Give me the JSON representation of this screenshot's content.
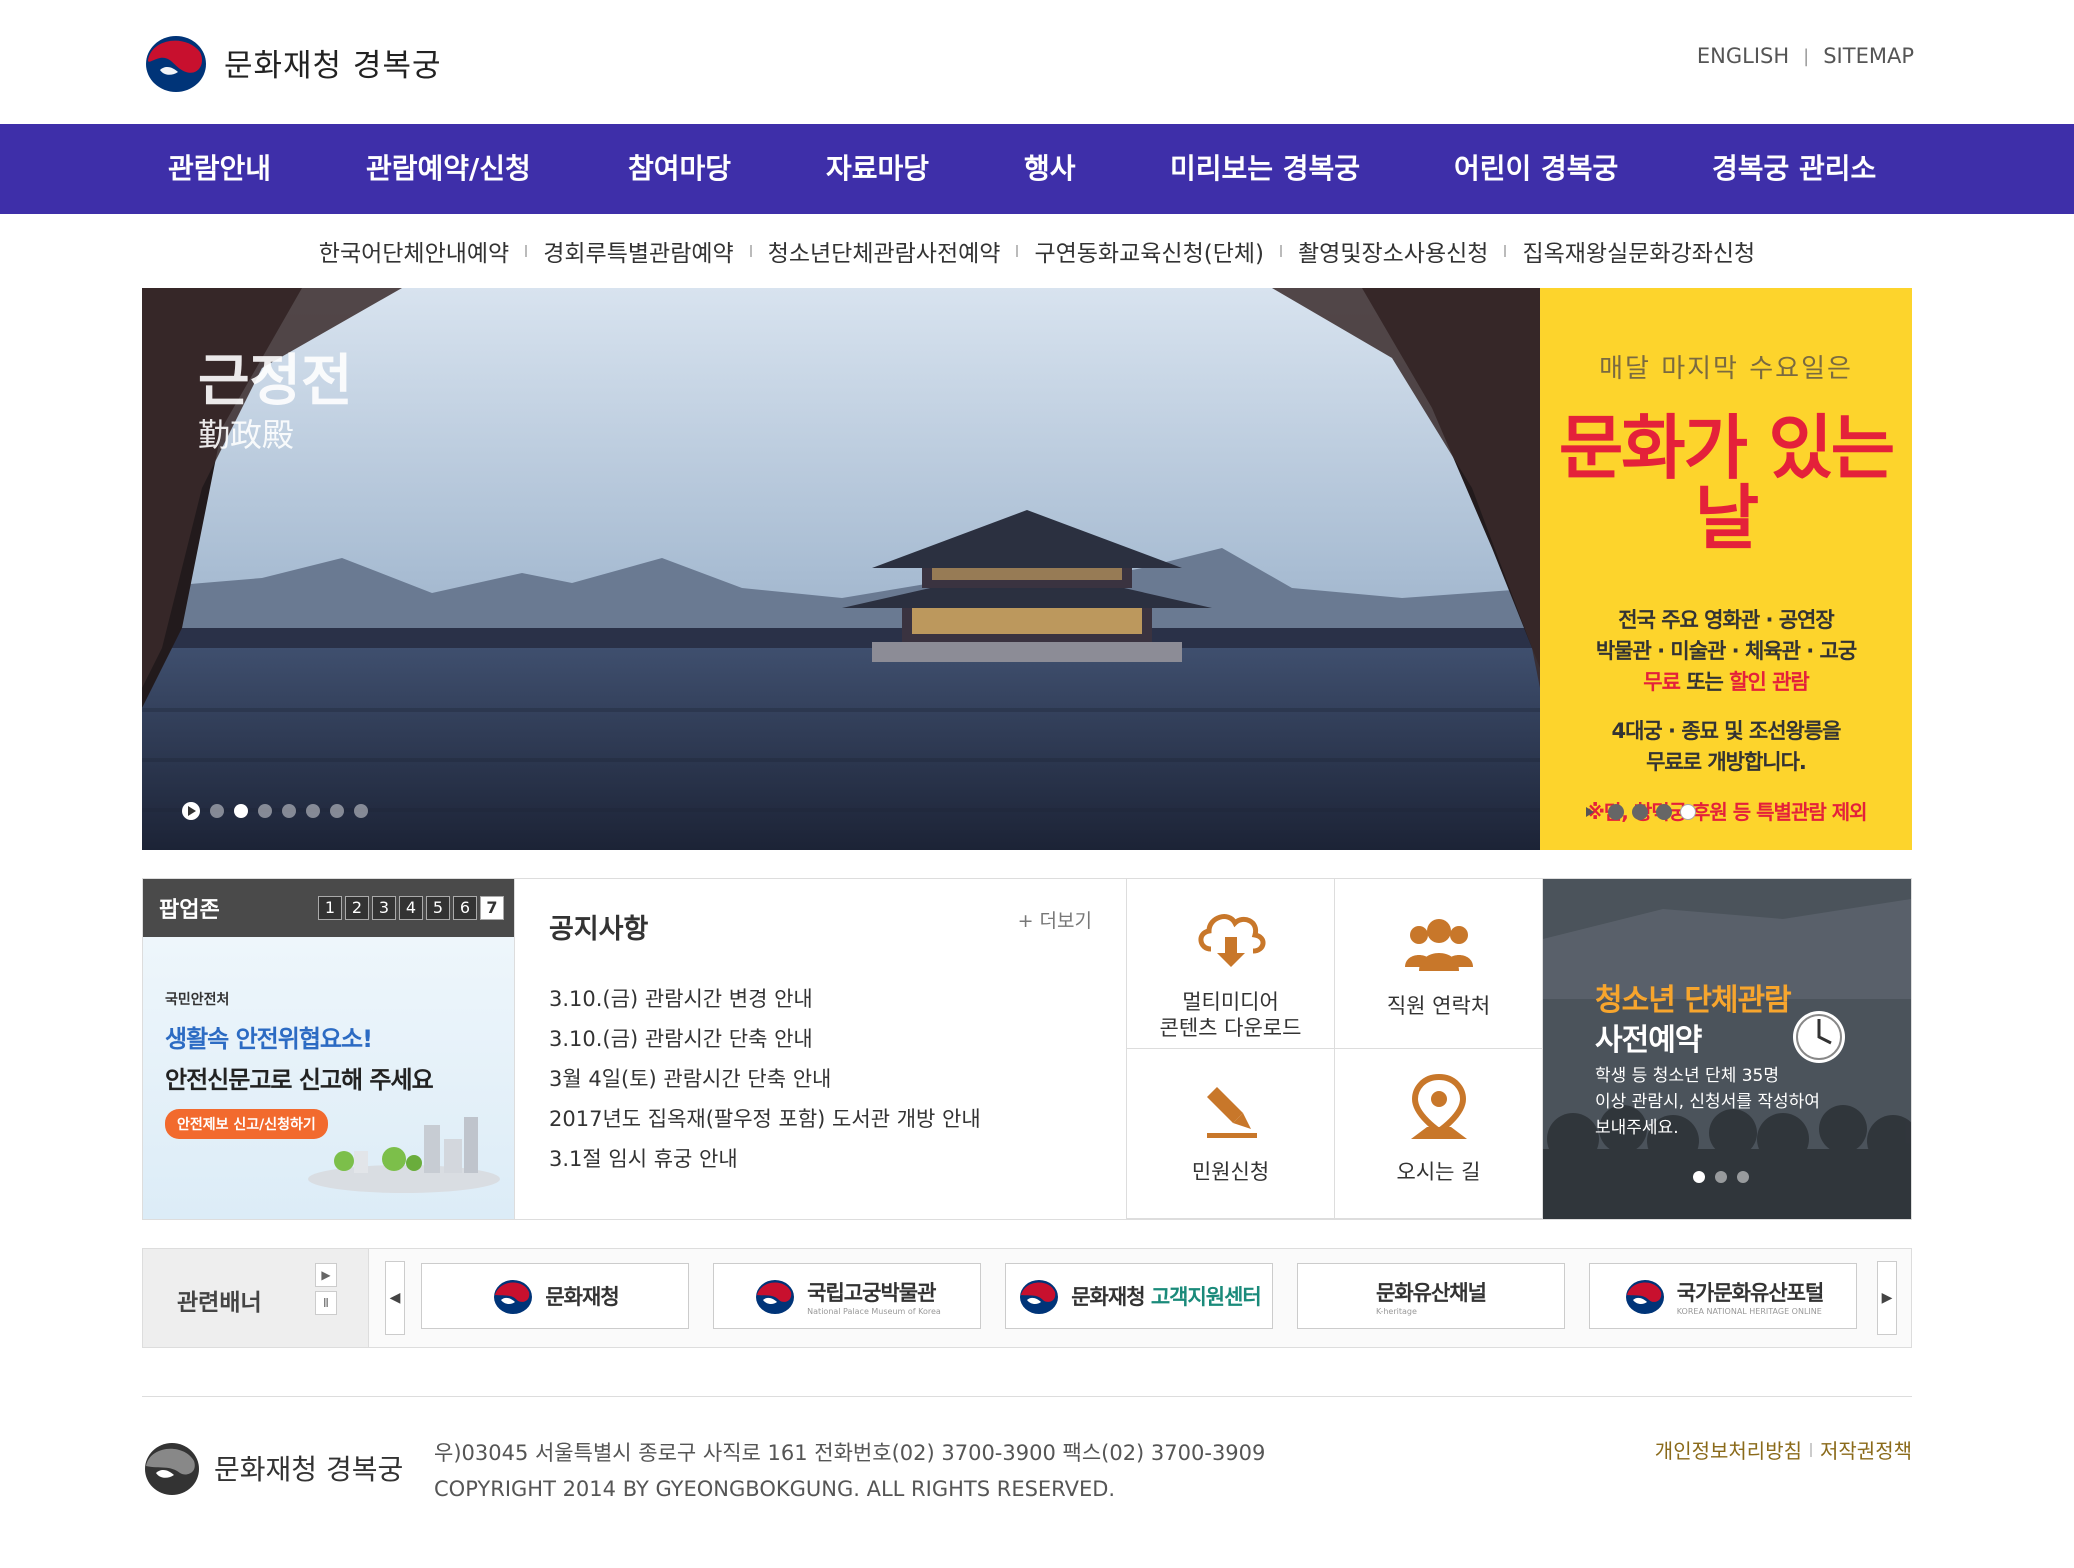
{
  "site": {
    "logo_text": "문화재청 경복궁"
  },
  "util": {
    "english": "ENGLISH",
    "sitemap": "SITEMAP"
  },
  "gnb": {
    "items": [
      "관람안내",
      "관람예약/신청",
      "참여마당",
      "자료마당",
      "행사",
      "미리보는 경복궁",
      "어린이 경복궁",
      "경복궁 관리소"
    ]
  },
  "sub_menu": {
    "items": [
      "한국어단체안내예약",
      "경회루특별관람예약",
      "청소년단체관람사전예약",
      "구연동화교육신청(단체)",
      "촬영및장소사용신청",
      "집옥재왕실문화강좌신청"
    ]
  },
  "visual": {
    "title": "근정전",
    "subtitle": "勤政殿",
    "slide_count": 7,
    "active_slide": 2
  },
  "side_banner": {
    "top": "매달 마지막 수요일은",
    "big": "문화가 있는 날",
    "line1": "전국 주요 영화관 · 공연장",
    "line2": "박물관 · 미술관 · 체육관 · 고궁",
    "free": "무료",
    "or": " 또는 ",
    "discount": "할인 관람",
    "line4": "4대궁 · 종묘 및 조선왕릉을",
    "line5": "무료로 개방합니다.",
    "note": "※단, 창덕궁 후원 등 특별관람 제외",
    "colors": {
      "background": "#fdd42c",
      "accent": "#e4213a"
    }
  },
  "popup": {
    "title": "팝업존",
    "numbers": [
      "1",
      "2",
      "3",
      "4",
      "5",
      "6",
      "7"
    ],
    "active": "7",
    "small": "국민안전처",
    "blue": "생활속 안전위협요소!",
    "black": "안전신문고로 신고해 주세요",
    "button": "안전제보 신고/신청하기"
  },
  "notice": {
    "title": "공지사항",
    "more": "+ 더보기",
    "items": [
      "3.10.(금) 관람시간 변경 안내",
      "3.10.(금) 관람시간 단축 안내",
      "3월 4일(토) 관람시간 단축 안내",
      "2017년도 집옥재(팔우정 포함) 도서관 개방 안내",
      "3.1절 임시 휴궁 안내"
    ]
  },
  "quick": {
    "multimedia_1": "멀티미디어",
    "multimedia_2": "콘텐츠 다운로드",
    "staff": "직원 연락처",
    "civil": "민원신청",
    "directions": "오시는 길",
    "icon_color": "#c8772a"
  },
  "youth": {
    "title1": "청소년 단체관람",
    "title2": "사전예약",
    "desc1": "학생 등 청소년 단체 35명",
    "desc2": "이상 관람시, 신청서를 작성하여",
    "desc3": "보내주세요."
  },
  "related": {
    "title": "관련배너",
    "next_icon": "▶",
    "pause_icon": "Ⅱ",
    "prev_arrow": "◀",
    "next_arrow": "▶",
    "items": [
      {
        "name": "문화재청",
        "sub": ""
      },
      {
        "name": "국립고궁박물관",
        "sub": "National Palace Museum of Korea"
      },
      {
        "name": "문화재청 ",
        "accent": "고객지원센터",
        "sub": ""
      },
      {
        "name": "문화유산채널",
        "sub": "K-heritage"
      },
      {
        "name": "국가문화유산포털",
        "sub": "KOREA NATIONAL HERITAGE ONLINE"
      }
    ]
  },
  "footer": {
    "logo_text": "문화재청 경복궁",
    "address": "우)03045 서울특별시 종로구 사직로 161 전화번호(02) 3700-3900 팩스(02) 3700-3909",
    "copyright": "COPYRIGHT 2014 BY GYEONGBOKGUNG. ALL RIGHTS RESERVED.",
    "privacy": "개인정보처리방침",
    "copyright_policy": "저작권정책"
  },
  "colors": {
    "gnb": "#3e2fa9",
    "taeguk_red": "#c8102e",
    "taeguk_blue": "#003478"
  }
}
